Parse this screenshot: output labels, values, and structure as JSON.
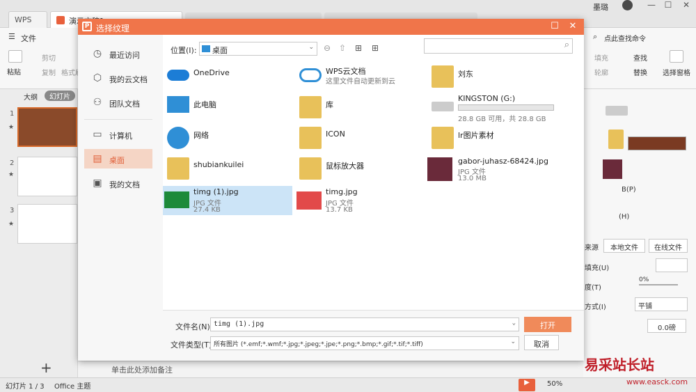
{
  "app": {
    "wps_tab": "WPS",
    "doc_tab": "演示文稿1",
    "user": "墨璐",
    "controls": [
      "—",
      "☐",
      "✕"
    ]
  },
  "ribbon": {
    "file_menu": "文件",
    "search_cmd": "点此查找命令",
    "tools": [
      "剪切",
      "复制",
      "格式刷",
      "粘贴"
    ],
    "right_tools": [
      "填充",
      "轮廓",
      "查找",
      "替换",
      "选择窗格"
    ]
  },
  "slide_panel": {
    "tabs": [
      "大纲",
      "幻灯片"
    ],
    "slides": [
      "1",
      "2",
      "3"
    ],
    "add": "+"
  },
  "notes": {
    "placeholder": "单击此处添加备注"
  },
  "status": {
    "slide_info": "幻灯片 1 / 3",
    "theme": "Office 主题",
    "zoom": "50%"
  },
  "right_panel": {
    "source_label": "来源",
    "local_file": "本地文件",
    "online_file": "在线文件",
    "fill_label": "填充(U)",
    "transparency_label": "度(T)",
    "transparency_value": "0%",
    "mode_label": "方式(I)",
    "mode_value": "平铺",
    "offset_value": "0.0磅",
    "shortcut_b": "B(P)",
    "shortcut_h": "(H)"
  },
  "dialog": {
    "title": "选择纹理",
    "sidebar": [
      {
        "label": "最近访问",
        "icon": "clock-icon"
      },
      {
        "label": "我的云文档",
        "icon": "cube-icon"
      },
      {
        "label": "团队文档",
        "icon": "team-icon"
      },
      {
        "label": "计算机",
        "icon": "computer-icon"
      },
      {
        "label": "桌面",
        "icon": "desktop-icon"
      },
      {
        "label": "我的文档",
        "icon": "document-icon"
      }
    ],
    "location_label": "位置(I):",
    "location_value": "桌面",
    "items": [
      {
        "name": "OneDrive",
        "sub": "",
        "sub2": "",
        "icon": "onedrive-icon"
      },
      {
        "name": "WPS云文档",
        "sub": "这里文件自动更新到云",
        "sub2": "",
        "icon": "wps-cloud-icon"
      },
      {
        "name": "刘东",
        "sub": "",
        "sub2": "",
        "icon": "user-folder-icon"
      },
      {
        "name": "此电脑",
        "sub": "",
        "sub2": "",
        "icon": "this-pc-icon"
      },
      {
        "name": "库",
        "sub": "",
        "sub2": "",
        "icon": "library-icon"
      },
      {
        "name": "KINGSTON (G:)",
        "sub": "28.8 GB 可用，共 28.8 GB",
        "sub2": "",
        "icon": "usb-drive-icon"
      },
      {
        "name": "网络",
        "sub": "",
        "sub2": "",
        "icon": "network-icon"
      },
      {
        "name": "ICON",
        "sub": "",
        "sub2": "",
        "icon": "icon-folder-icon"
      },
      {
        "name": "lr图片素材",
        "sub": "",
        "sub2": "",
        "icon": "folder-icon"
      },
      {
        "name": "shubiankuilei",
        "sub": "",
        "sub2": "",
        "icon": "folder-icon"
      },
      {
        "name": "鼠标放大器",
        "sub": "",
        "sub2": "",
        "icon": "folder-icon"
      },
      {
        "name": "gabor-juhasz-68424.jpg",
        "sub": "JPG 文件",
        "sub2": "13.0 MB",
        "icon": "image-thumb-icon"
      },
      {
        "name": "timg (1).jpg",
        "sub": "JPG 文件",
        "sub2": "27.4 KB",
        "icon": "image-thumb-icon"
      },
      {
        "name": "timg.jpg",
        "sub": "JPG 文件",
        "sub2": "13.7 KB",
        "icon": "image-thumb-icon"
      }
    ],
    "filename_label": "文件名(N):",
    "filename_value": "timg (1).jpg",
    "filetype_label": "文件类型(T):",
    "filetype_value": "所有图片 (*.emf;*.wmf;*.jpg;*.jpeg;*.jpe;*.png;*.bmp;*.gif;*.tif;*.tiff)",
    "open_label": "打开",
    "cancel_label": "取消"
  },
  "watermark": {
    "text": "易采站长站",
    "url": "www.easck.com"
  }
}
